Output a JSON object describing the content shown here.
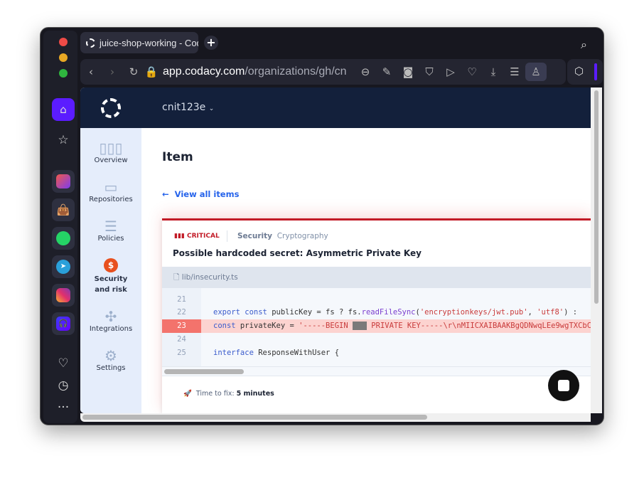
{
  "browser": {
    "tab_title": "juice-shop-working - Codacy",
    "url_host": "app.codacy.com",
    "url_path": "/organizations/gh/cnit",
    "new_tab_icon": "+",
    "icons": [
      "back",
      "forward",
      "reload",
      "lock",
      "zoom-out",
      "edit",
      "camera",
      "shield",
      "send",
      "heart",
      "download",
      "settings",
      "profile",
      "cube"
    ]
  },
  "rail": {
    "items": [
      "home",
      "bookmarks",
      "aria",
      "shop",
      "whatsapp",
      "telegram",
      "instagram",
      "music",
      "heart",
      "history",
      "more"
    ]
  },
  "app": {
    "org": "cnit123e",
    "nav": [
      {
        "label": "Overview"
      },
      {
        "label": "Repositories"
      },
      {
        "label": "Policies"
      },
      {
        "label": "Security and risk",
        "line1": "Security",
        "line2": "and risk",
        "active": true
      },
      {
        "label": "Integrations"
      },
      {
        "label": "Settings"
      }
    ],
    "page_title": "Item",
    "back_link": "View all items",
    "issue": {
      "severity": "CRITICAL",
      "category": "Security",
      "subcategory": "Cryptography",
      "title": "Possible hardcoded secret: Asymmetric Private Key",
      "file": "lib/insecurity.ts",
      "lines": [
        {
          "n": "21",
          "code": ""
        },
        {
          "n": "22",
          "code": "export const publicKey = fs ? fs.readFileSync('encryptionkeys/jwt.pub', 'utf8') :"
        },
        {
          "n": "23",
          "code": "const privateKey = '-----BEGIN ███ PRIVATE KEY-----\\r\\nMIICXAIBAAKBgQDNwqLEe9wgTXCbC"
        },
        {
          "n": "24",
          "code": ""
        },
        {
          "n": "25",
          "code": "interface ResponseWithUser {"
        }
      ],
      "l22": {
        "a": "export",
        "b": "const",
        "c": " publicKey = fs ? fs.",
        "d": "readFileSync",
        "e": "(",
        "f": "'encryptionkeys/jwt.pub'",
        "g": ", ",
        "h": "'utf8'",
        "i": ") :"
      },
      "l23": {
        "a": "const",
        "b": " privateKey = ",
        "c": "'-----BEGIN ",
        "d": " PRIVATE KEY-----\\r\\nMIICXAIBAAKBgQDNwqLEe9wgTXCbC"
      },
      "l25": {
        "a": "interface",
        "b": " ResponseWithUser {"
      },
      "time_label": "Time to fix:",
      "time_value": "5 minutes"
    }
  },
  "colors": {
    "critical": "#c21a26",
    "header": "#13203b",
    "accent": "#2563eb",
    "rail_active": "#5b1cff"
  }
}
